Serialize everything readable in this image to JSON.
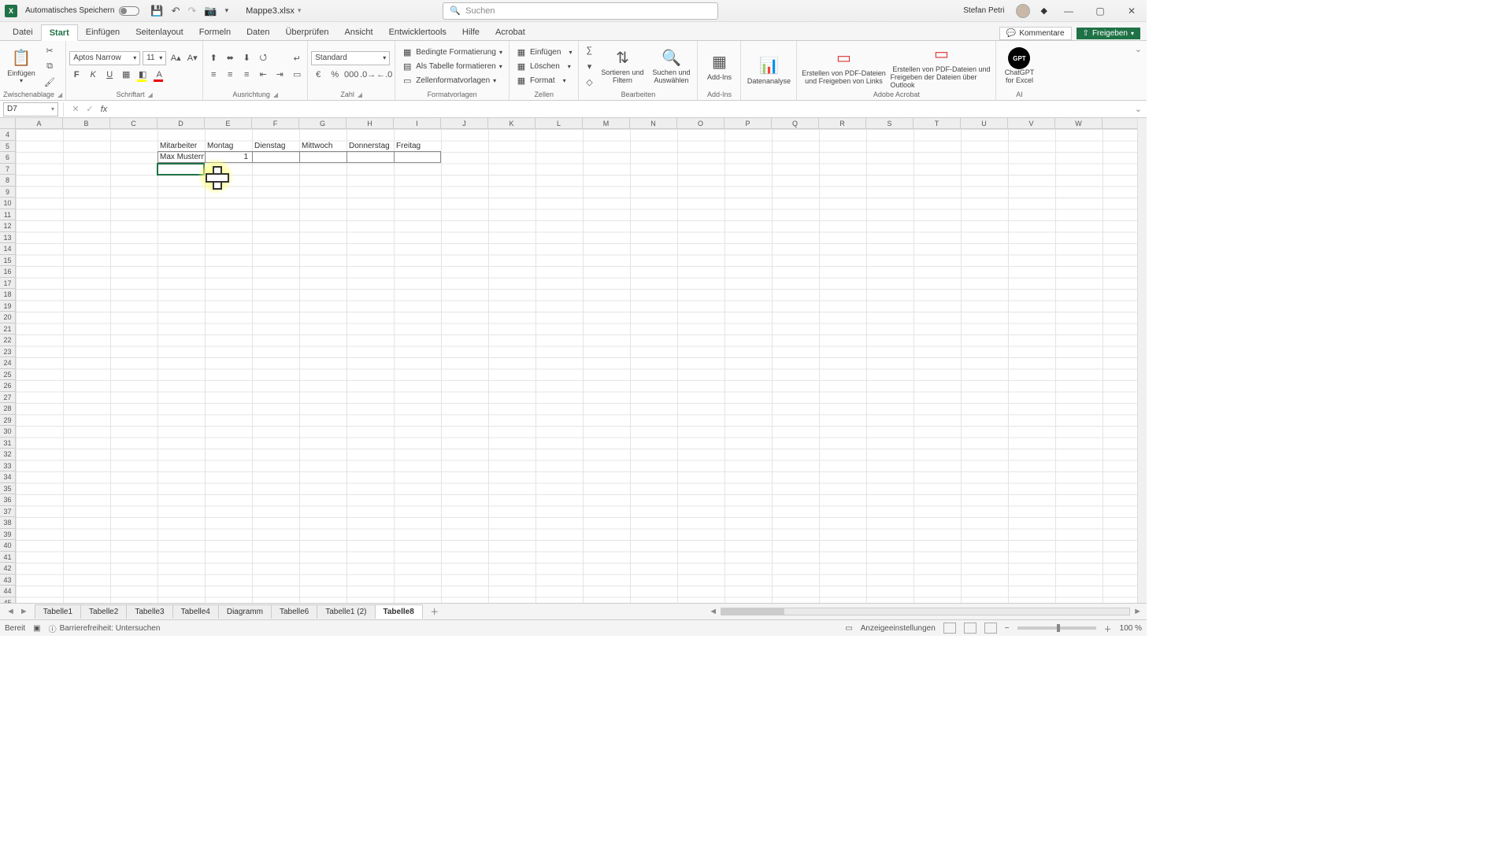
{
  "title": {
    "autosave": "Automatisches Speichern",
    "docname": "Mappe3.xlsx",
    "search_placeholder": "Suchen",
    "user": "Stefan Petri"
  },
  "menutabs": [
    "Datei",
    "Start",
    "Einfügen",
    "Seitenlayout",
    "Formeln",
    "Daten",
    "Überprüfen",
    "Ansicht",
    "Entwicklertools",
    "Hilfe",
    "Acrobat"
  ],
  "menuright": {
    "comments": "Kommentare",
    "share": "Freigeben"
  },
  "ribbon": {
    "clipboard": {
      "paste": "Einfügen",
      "label": "Zwischenablage"
    },
    "font": {
      "name": "Aptos Narrow",
      "size": "11",
      "label": "Schriftart"
    },
    "align": {
      "label": "Ausrichtung"
    },
    "number": {
      "format": "Standard",
      "label": "Zahl"
    },
    "styles": {
      "cond": "Bedingte Formatierung",
      "table": "Als Tabelle formatieren",
      "cell": "Zellenformatvorlagen",
      "label": "Formatvorlagen"
    },
    "cells": {
      "insert": "Einfügen",
      "delete": "Löschen",
      "format": "Format",
      "label": "Zellen"
    },
    "editing": {
      "sort": "Sortieren und Filtern",
      "find": "Suchen und Auswählen",
      "label": "Bearbeiten"
    },
    "addins": {
      "addins": "Add-Ins",
      "label": "Add-Ins"
    },
    "data": {
      "analysis": "Datenanalyse"
    },
    "acrobat": {
      "pdf1a": "Erstellen von PDF-Dateien",
      "pdf1b": "und Freigeben von Links",
      "pdf2a": "Erstellen von PDF-Dateien und",
      "pdf2b": "Freigeben der Dateien über Outlook",
      "label": "Adobe Acrobat"
    },
    "ai": {
      "gpt": "ChatGPT for Excel",
      "label": "AI"
    }
  },
  "fx": {
    "ref": "D7",
    "value": ""
  },
  "columns": [
    "A",
    "B",
    "C",
    "D",
    "E",
    "F",
    "G",
    "H",
    "I",
    "J",
    "K",
    "L",
    "M",
    "N",
    "O",
    "P",
    "Q",
    "R",
    "S",
    "T",
    "U",
    "V",
    "W"
  ],
  "rowstart": 4,
  "rowcount": 42,
  "data": {
    "headers": [
      "Mitarbeiter",
      "Montag",
      "Dienstag",
      "Mittwoch",
      "Donnerstag",
      "Freitag"
    ],
    "r6_name": "Max Mustermann",
    "r6_mon": "1"
  },
  "sheets": [
    "Tabelle1",
    "Tabelle2",
    "Tabelle3",
    "Tabelle4",
    "Diagramm",
    "Tabelle6",
    "Tabelle1 (2)",
    "Tabelle8"
  ],
  "sheet_active": 7,
  "status": {
    "ready": "Bereit",
    "acc": "Barrierefreiheit: Untersuchen",
    "disp": "Anzeigeeinstellungen",
    "zoom": "100 %"
  }
}
